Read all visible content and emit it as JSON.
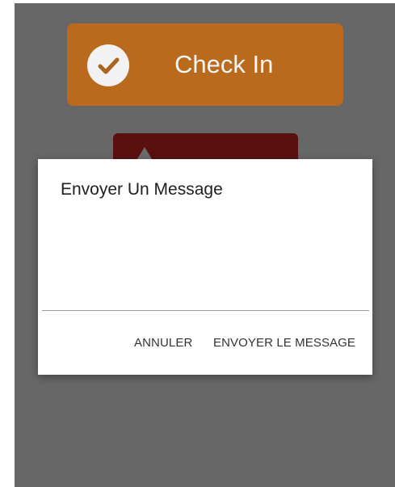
{
  "background": {
    "checkin_button": {
      "label": "Check In",
      "icon": "check-circle-icon",
      "color": "#b96a1d"
    },
    "alert_button": {
      "icon": "warning-icon",
      "color": "#5b1010"
    }
  },
  "dialog": {
    "title": "Envoyer Un Message",
    "message_input": {
      "value": "",
      "placeholder": ""
    },
    "actions": {
      "cancel_label": "ANNULER",
      "send_label": "ENVOYER LE MESSAGE"
    }
  },
  "colors": {
    "scrim": "#676767",
    "dialog_bg": "#ffffff",
    "text": "#202020"
  }
}
